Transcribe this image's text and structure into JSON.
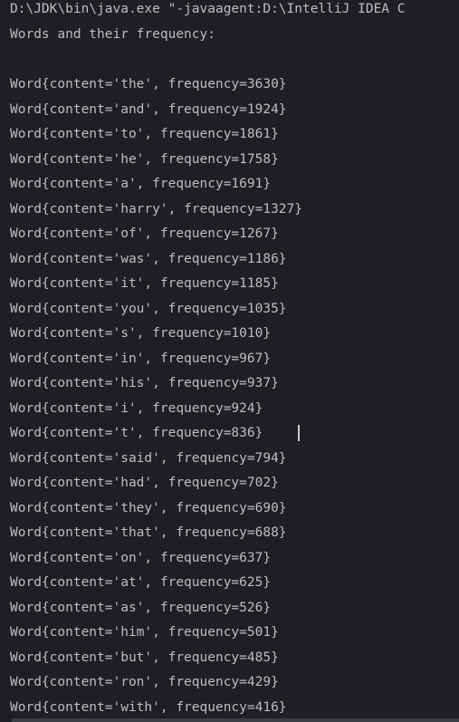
{
  "console": {
    "command_line": "D:\\JDK\\bin\\java.exe \"-javaagent:D:\\IntelliJ IDEA C",
    "header": "Words and their frequency:",
    "lines": [
      "Word{content='the', frequency=3630}",
      "Word{content='and', frequency=1924}",
      "Word{content='to', frequency=1861}",
      "Word{content='he', frequency=1758}",
      "Word{content='a', frequency=1691}",
      "Word{content='harry', frequency=1327}",
      "Word{content='of', frequency=1267}",
      "Word{content='was', frequency=1186}",
      "Word{content='it', frequency=1185}",
      "Word{content='you', frequency=1035}",
      "Word{content='s', frequency=1010}",
      "Word{content='in', frequency=967}",
      "Word{content='his', frequency=937}",
      "Word{content='i', frequency=924}",
      "Word{content='t', frequency=836}",
      "Word{content='said', frequency=794}",
      "Word{content='had', frequency=702}",
      "Word{content='they', frequency=690}",
      "Word{content='that', frequency=688}",
      "Word{content='on', frequency=637}",
      "Word{content='at', frequency=625}",
      "Word{content='as', frequency=526}",
      "Word{content='him', frequency=501}",
      "Word{content='but', frequency=485}",
      "Word{content='ron', frequency=429}",
      "Word{content='with', frequency=416}"
    ]
  },
  "colors": {
    "background": "#1e1f22",
    "text": "#bcbec4"
  }
}
